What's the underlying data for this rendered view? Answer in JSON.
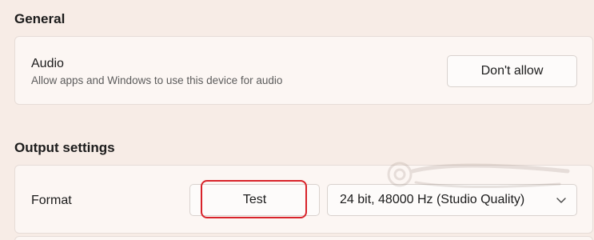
{
  "sections": {
    "general_title": "General",
    "output_title": "Output settings"
  },
  "audio": {
    "title": "Audio",
    "subtitle": "Allow apps and Windows to use this device for audio",
    "button_label": "Don't allow"
  },
  "format": {
    "label": "Format",
    "test_button_label": "Test",
    "selected_value": "24 bit, 48000 Hz (Studio Quality)"
  },
  "icons": {
    "dropdown": "chevron-down-icon",
    "watermark": "quantrimang-logo-icon"
  },
  "colors": {
    "highlight": "#d8232a",
    "background": "#f7ece6",
    "card": "#fcf6f3"
  }
}
